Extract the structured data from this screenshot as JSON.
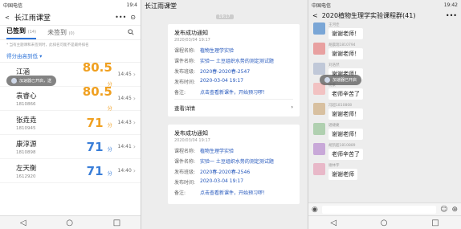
{
  "phone_left": {
    "status": {
      "carrier": "中国电信",
      "time": "19:4"
    },
    "header": {
      "back": "<",
      "title": "长江雨课堂",
      "more": "•••",
      "close": "⊙"
    },
    "tabs": [
      {
        "label": "已签到",
        "count": "(14)"
      },
      {
        "label": "未签到",
        "count": "(0)"
      }
    ],
    "search_icon": "search-icon",
    "notice": "* 当有主题课和未签到时，此排名可能不是最终排名",
    "sort_label": "得分由高到低 ▾",
    "floating_bubble": "加速器已开启，送",
    "students": [
      {
        "name": "江涵",
        "sid": "1710764",
        "score": "80.5",
        "unit": "分",
        "time": "14:45",
        "color": "#f0a020"
      },
      {
        "name": "袁睿心",
        "sid": "1810866",
        "score": "80.5",
        "unit": "分",
        "time": "14:45",
        "color": "#f0a020"
      },
      {
        "name": "张垚垚",
        "sid": "1810945",
        "score": "71",
        "unit": "分",
        "time": "14:43",
        "color": "#f0a020"
      },
      {
        "name": "康淳源",
        "sid": "1810898",
        "score": "71",
        "unit": "分",
        "time": "14:41",
        "color": "#3a7ed8"
      },
      {
        "name": "左天衡",
        "sid": "1612920",
        "score": "71",
        "unit": "分",
        "time": "14:40",
        "color": "#3a7ed8"
      }
    ]
  },
  "phone_mid": {
    "title": "长江雨课堂",
    "time_stamp": "19:17",
    "cards": [
      {
        "title": "发布成功通知",
        "date": "2020/03/04 19:17",
        "rows": [
          {
            "k": "课程名称:",
            "v": "植物生理学实验"
          },
          {
            "k": "课件名称:",
            "v": "实验一 土豆组织水势的测定测试题"
          },
          {
            "k": "发布班级:",
            "v": "2020春-2020春-2547"
          },
          {
            "k": "发布时间:",
            "v": "2020-03-04 19:17"
          },
          {
            "k": "备注:",
            "v": "点击查看新课件，开始预习啰！"
          }
        ],
        "detail": "查看详情"
      },
      {
        "title": "发布成功通知",
        "date": "2020/03/04 19:17",
        "rows": [
          {
            "k": "课程名称:",
            "v": "植物生理学实验"
          },
          {
            "k": "课件名称:",
            "v": "实验一 土豆组织水势的测定测试题"
          },
          {
            "k": "发布班级:",
            "v": "2020春-2020春-2546"
          },
          {
            "k": "发布时间:",
            "v": "2020-03-04 19:17"
          },
          {
            "k": "备注:",
            "v": "点击查看新课件，开始预习啰！"
          }
        ]
      }
    ]
  },
  "phone_right": {
    "status": {
      "carrier": "中国电信",
      "time": "19:42"
    },
    "header": {
      "back": "<",
      "title": "2020植物生理学实验课程群(41)",
      "more": "•••"
    },
    "floating_bubble": "加速器已开启",
    "messages": [
      {
        "name": "王河佳",
        "text": "谢谢老师！",
        "avatar": "#7aa6d6"
      },
      {
        "name": "胡晨瑞1810794",
        "text": "谢谢老师！",
        "avatar": "#e8a0a0"
      },
      {
        "name": "刘浩然",
        "text": "谢谢老师！",
        "avatar": "#c0c8d8"
      },
      {
        "name": "杨豪",
        "text": "老师辛苦了",
        "avatar": "#f2c2c2"
      },
      {
        "name": "冯超1810808",
        "text": "谢谢老师！",
        "avatar": "#d8c0a0"
      },
      {
        "name": "谌婕婕",
        "text": "谢谢老师！",
        "avatar": "#b0d0b0"
      },
      {
        "name": "胡凯超1810889",
        "text": "老师辛苦了",
        "avatar": "#c8a8d8"
      },
      {
        "name": "谢林宇",
        "text": "谢谢老师",
        "avatar": "#e8b8c8"
      }
    ]
  },
  "navbar": {
    "back": "◁",
    "home": "○",
    "recent": "□"
  }
}
